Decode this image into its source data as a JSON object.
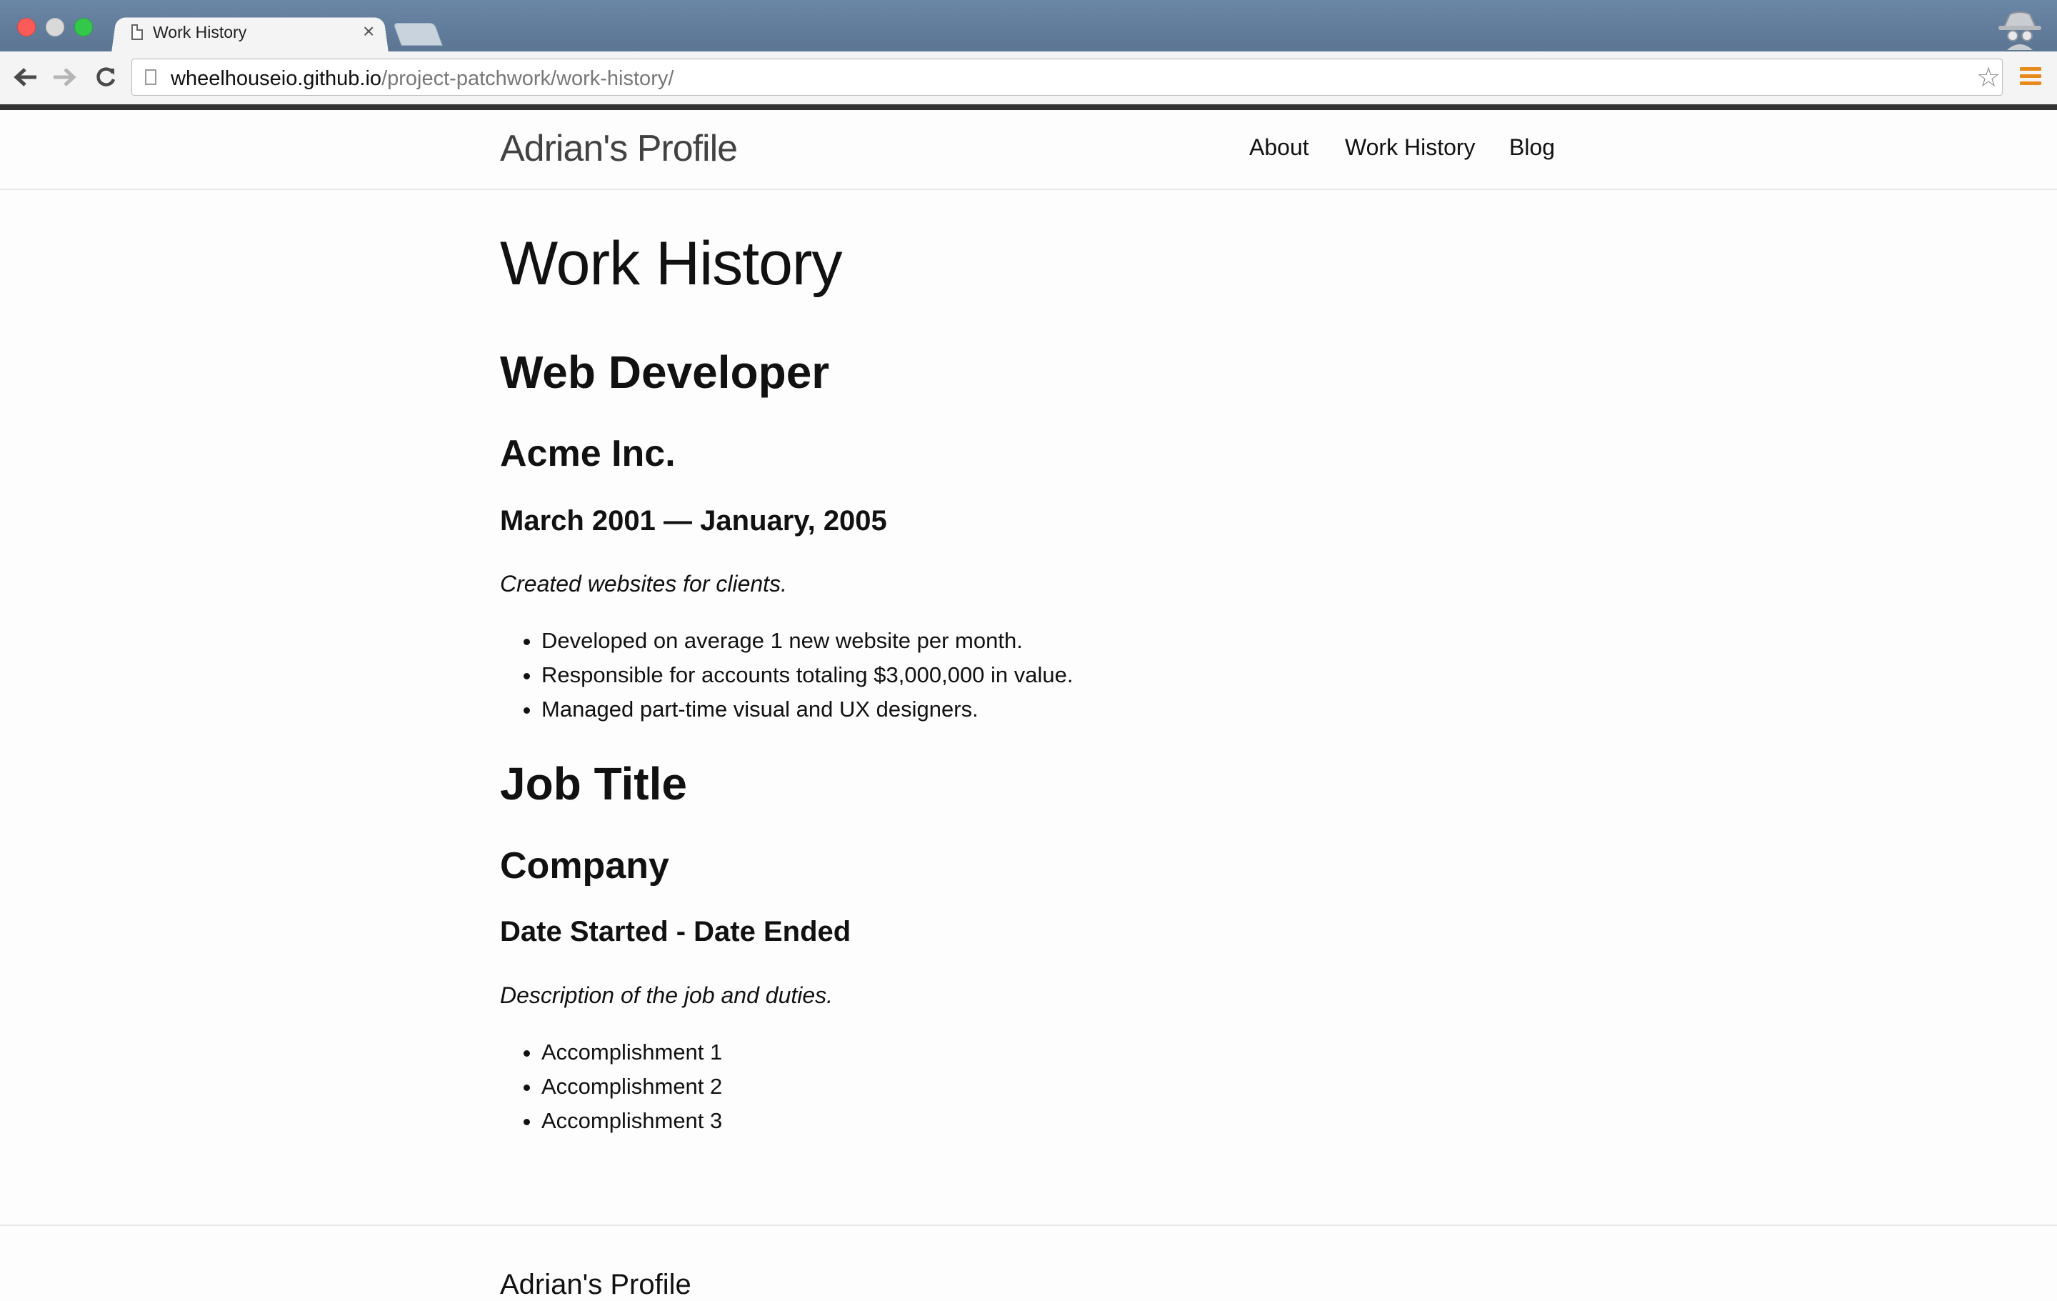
{
  "browser": {
    "tab_title": "Work History",
    "url_host": "wheelhouseio.github.io",
    "url_path": "/project-patchwork/work-history/"
  },
  "site": {
    "title": "Adrian's Profile",
    "nav": [
      "About",
      "Work History",
      "Blog"
    ]
  },
  "main": {
    "page_title": "Work History",
    "jobs": [
      {
        "title": "Web Developer",
        "company": "Acme Inc.",
        "dates": "March 2001 — January, 2005",
        "description": "Created websites for clients.",
        "accomplishments": [
          "Developed on average 1 new website per month.",
          "Responsible for accounts totaling $3,000,000 in value.",
          "Managed part-time visual and UX designers."
        ]
      },
      {
        "title": "Job Title",
        "company": "Company",
        "dates": "Date Started - Date Ended",
        "description": "Description of the job and duties.",
        "accomplishments": [
          "Accomplishment 1",
          "Accomplishment 2",
          "Accomplishment 3"
        ]
      }
    ]
  },
  "footer": {
    "title": "Adrian's Profile"
  },
  "colors": {
    "titlebar": "#5b7593",
    "menu_accent": "#e8891b"
  }
}
